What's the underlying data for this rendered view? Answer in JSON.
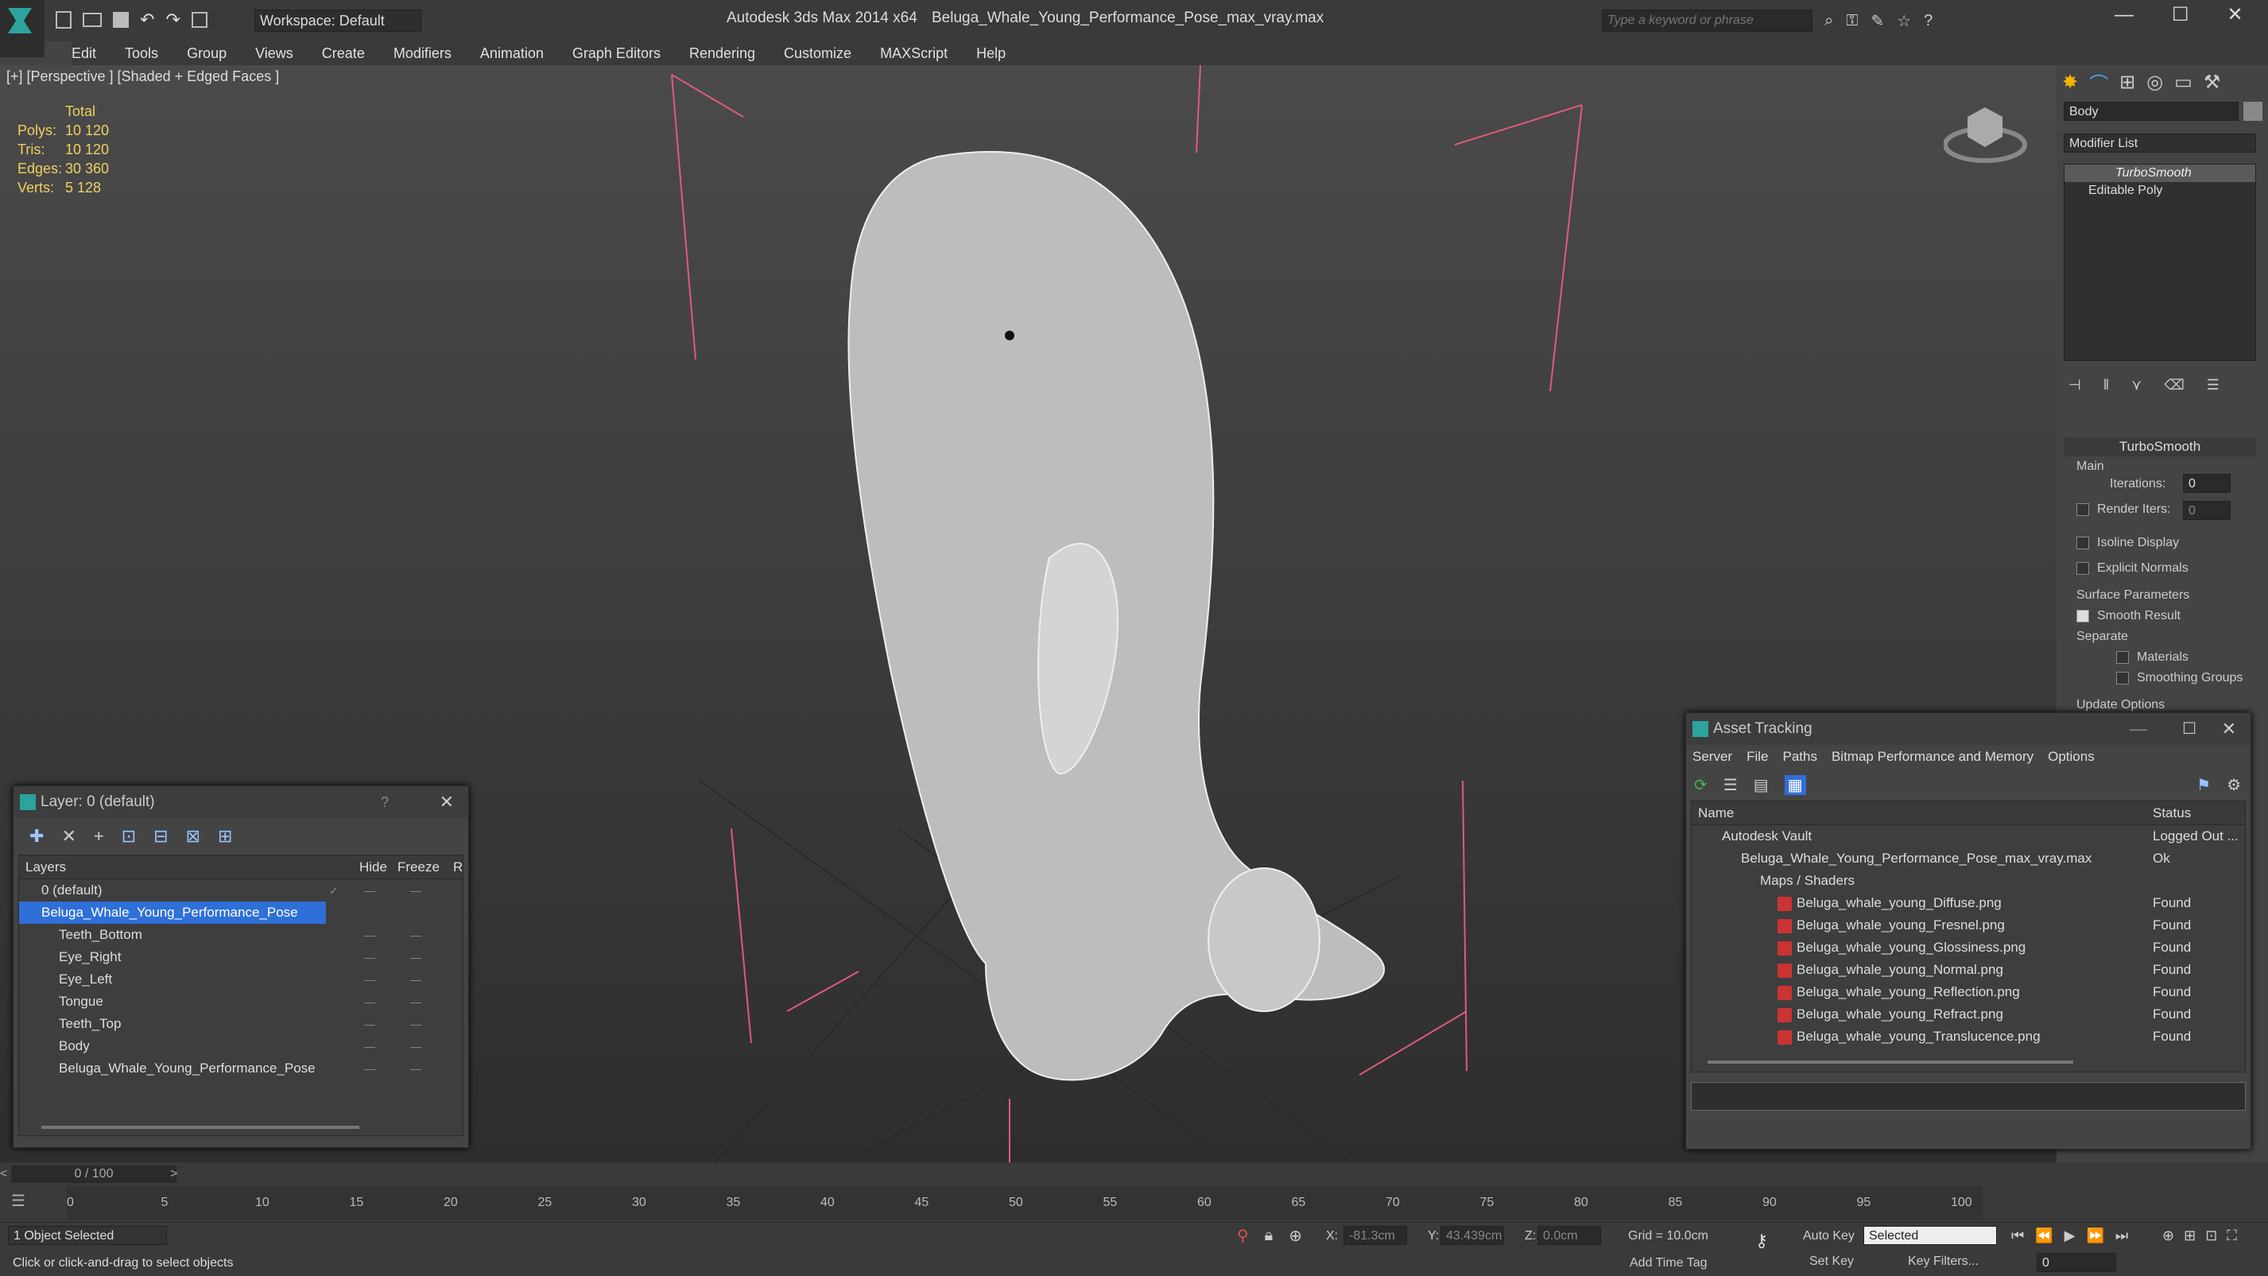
{
  "app": {
    "title": "Autodesk 3ds Max  2014 x64",
    "file": "Beluga_Whale_Young_Performance_Pose_max_vray.max",
    "workspace": "Workspace: Default",
    "search_placeholder": "Type a keyword or phrase"
  },
  "menu": [
    "Edit",
    "Tools",
    "Group",
    "Views",
    "Create",
    "Modifiers",
    "Animation",
    "Graph Editors",
    "Rendering",
    "Customize",
    "MAXScript",
    "Help"
  ],
  "viewport": {
    "label": "[+] [Perspective ] [Shaded + Edged Faces ]",
    "stats_header": "Total",
    "stats": [
      {
        "k": "Polys:",
        "v": "10 120"
      },
      {
        "k": "Tris:",
        "v": "10 120"
      },
      {
        "k": "Edges:",
        "v": "30 360"
      },
      {
        "k": "Verts:",
        "v": "5 128"
      }
    ]
  },
  "command_panel": {
    "object_name": "Body",
    "modifier_list": "Modifier List",
    "stack": [
      "TurboSmooth",
      "Editable Poly"
    ],
    "rollout": "TurboSmooth",
    "main": "Main",
    "iterations_label": "Iterations:",
    "iterations": "0",
    "render_iters_label": "Render Iters:",
    "render_iters": "0",
    "isoline": "Isoline Display",
    "explicit_normals": "Explicit Normals",
    "surface_params": "Surface Parameters",
    "smooth_result": "Smooth Result",
    "separate": "Separate",
    "materials": "Materials",
    "smoothing_groups": "Smoothing Groups",
    "update_options": "Update Options"
  },
  "layer_dialog": {
    "title": "Layer: 0 (default)",
    "help": "?",
    "col_layers": "Layers",
    "col_hide": "Hide",
    "col_freeze": "Freeze",
    "col_r": "R",
    "rows": [
      {
        "name": "0 (default)",
        "indent": 1
      },
      {
        "name": "Beluga_Whale_Young_Performance_Pose",
        "indent": 1,
        "selected": true
      },
      {
        "name": "Teeth_Bottom",
        "indent": 2
      },
      {
        "name": "Eye_Right",
        "indent": 2
      },
      {
        "name": "Eye_Left",
        "indent": 2
      },
      {
        "name": "Tongue",
        "indent": 2
      },
      {
        "name": "Teeth_Top",
        "indent": 2
      },
      {
        "name": "Body",
        "indent": 2
      },
      {
        "name": "Beluga_Whale_Young_Performance_Pose",
        "indent": 2
      }
    ]
  },
  "asset_tracking": {
    "title": "Asset Tracking",
    "menu": [
      "Server",
      "File",
      "Paths",
      "Bitmap Performance and Memory",
      "Options"
    ],
    "col_name": "Name",
    "col_status": "Status",
    "rows": [
      {
        "name": "Autodesk Vault",
        "status": "Logged Out ...",
        "indent": 1
      },
      {
        "name": "Beluga_Whale_Young_Performance_Pose_max_vray.max",
        "status": "Ok",
        "indent": 2
      },
      {
        "name": "Maps / Shaders",
        "status": "",
        "indent": 3
      },
      {
        "name": "Beluga_whale_young_Diffuse.png",
        "status": "Found",
        "indent": 4
      },
      {
        "name": "Beluga_whale_young_Fresnel.png",
        "status": "Found",
        "indent": 4
      },
      {
        "name": "Beluga_whale_young_Glossiness.png",
        "status": "Found",
        "indent": 4
      },
      {
        "name": "Beluga_whale_young_Normal.png",
        "status": "Found",
        "indent": 4
      },
      {
        "name": "Beluga_whale_young_Reflection.png",
        "status": "Found",
        "indent": 4
      },
      {
        "name": "Beluga_whale_young_Refract.png",
        "status": "Found",
        "indent": 4
      },
      {
        "name": "Beluga_whale_young_Translucence.png",
        "status": "Found",
        "indent": 4
      }
    ]
  },
  "timeline": {
    "frame": "0 / 100",
    "ticks": [
      "0",
      "5",
      "10",
      "15",
      "20",
      "25",
      "30",
      "35",
      "40",
      "45",
      "50",
      "55",
      "60",
      "65",
      "70",
      "75",
      "80",
      "85",
      "90",
      "95",
      "100"
    ]
  },
  "status": {
    "selected": "1 Object Selected",
    "prompt": "Click or click-and-drag to select objects",
    "x_label": "X:",
    "x": "-81.3cm",
    "y_label": "Y:",
    "y": "43.439cm",
    "z_label": "Z:",
    "z": "0.0cm",
    "grid": "Grid = 10.0cm",
    "auto_key": "Auto Key",
    "selected_dd": "Selected",
    "set_key": "Set Key",
    "key_filters": "Key Filters...",
    "add_time_tag": "Add Time Tag",
    "frame_field": "0"
  }
}
